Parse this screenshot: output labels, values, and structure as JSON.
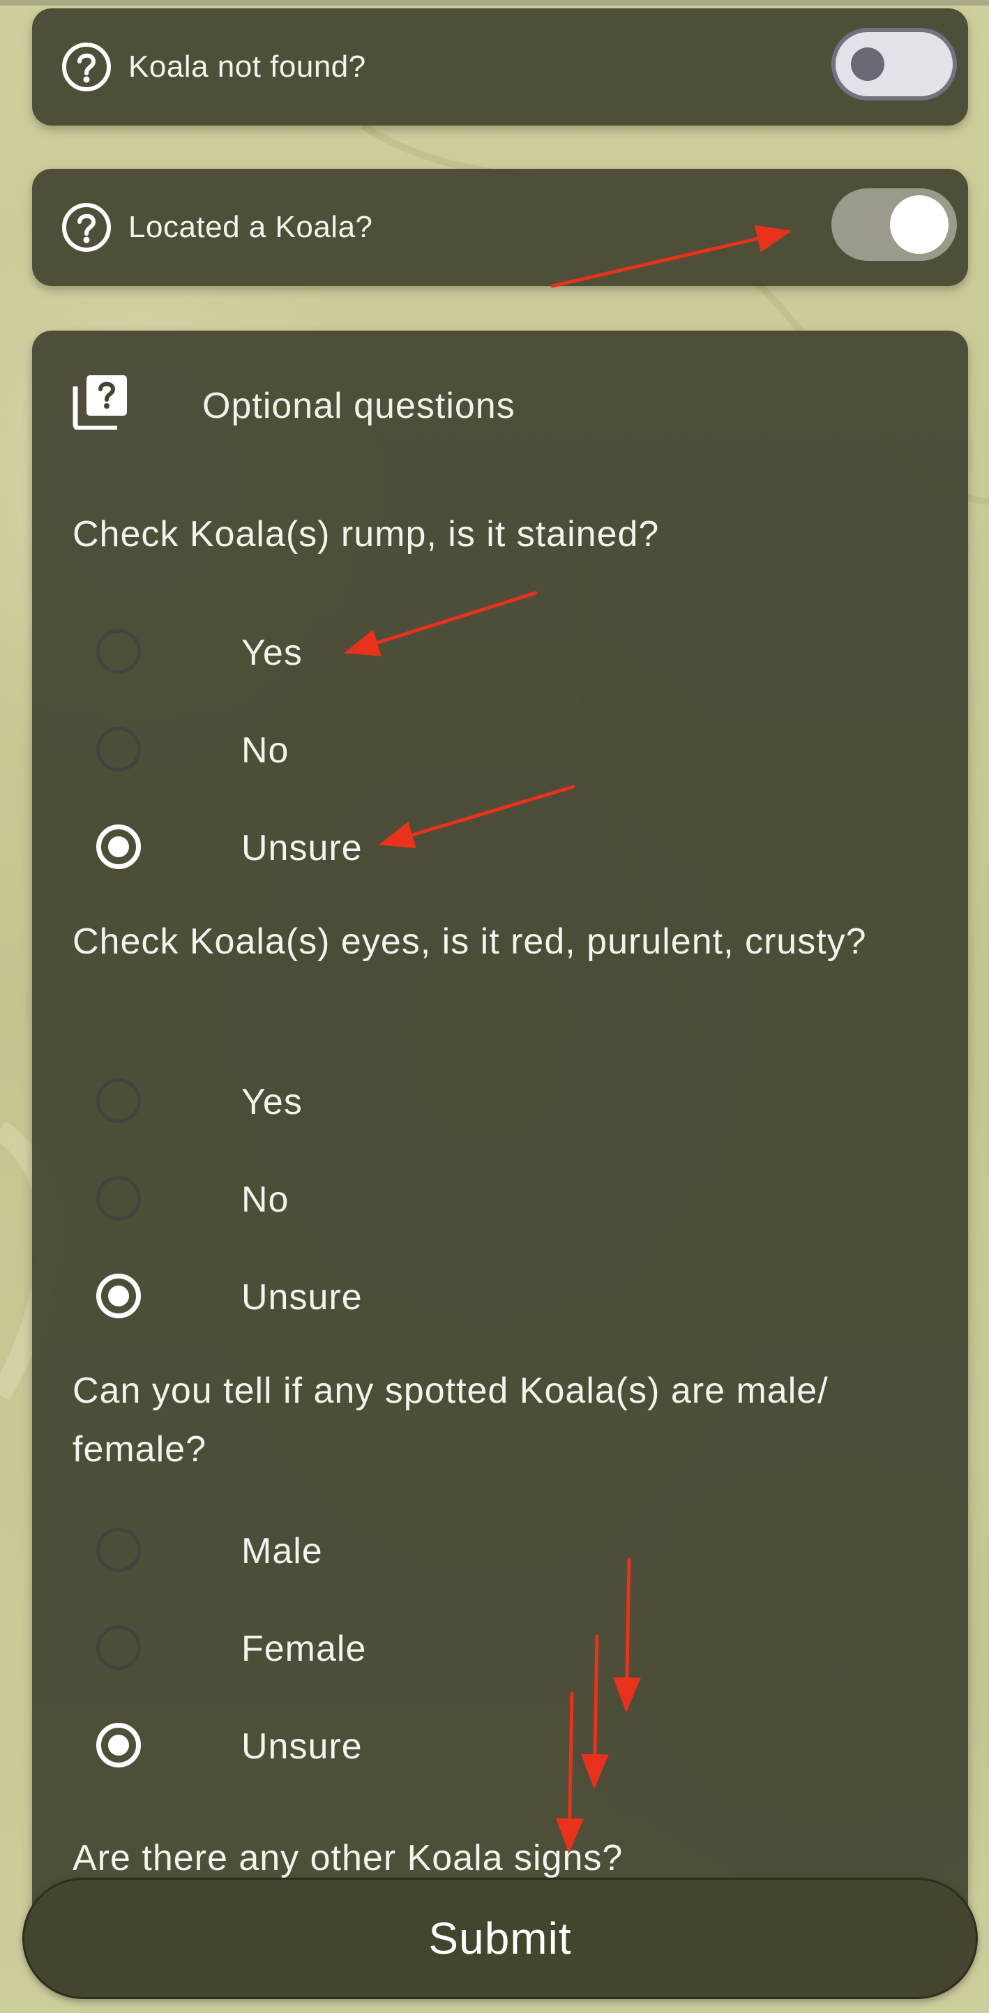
{
  "toggles": [
    {
      "label": "Koala not found?",
      "state": "off",
      "icon": "help-circle-icon"
    },
    {
      "label": "Located a Koala?",
      "state": "on",
      "icon": "help-circle-icon"
    }
  ],
  "optional": {
    "title": "Optional questions",
    "icon": "quiz-icon",
    "questions": [
      {
        "text": "Check Koala(s) rump, is it stained?",
        "options": [
          "Yes",
          "No",
          "Unsure"
        ],
        "selected": "Unsure"
      },
      {
        "text": "Check Koala(s) eyes, is it red, purulent, crusty?",
        "options": [
          "Yes",
          "No",
          "Unsure"
        ],
        "selected": "Unsure"
      },
      {
        "text": "Can you tell if any spotted Koala(s) are male/ female?",
        "options": [
          "Male",
          "Female",
          "Unsure"
        ],
        "selected": "Unsure"
      }
    ],
    "next_question_partial": "Are there any other Koala signs?"
  },
  "submit_label": "Submit",
  "colors": {
    "card": "#444432",
    "background": "#c9c995",
    "annotation_arrow": "#e8321c"
  }
}
